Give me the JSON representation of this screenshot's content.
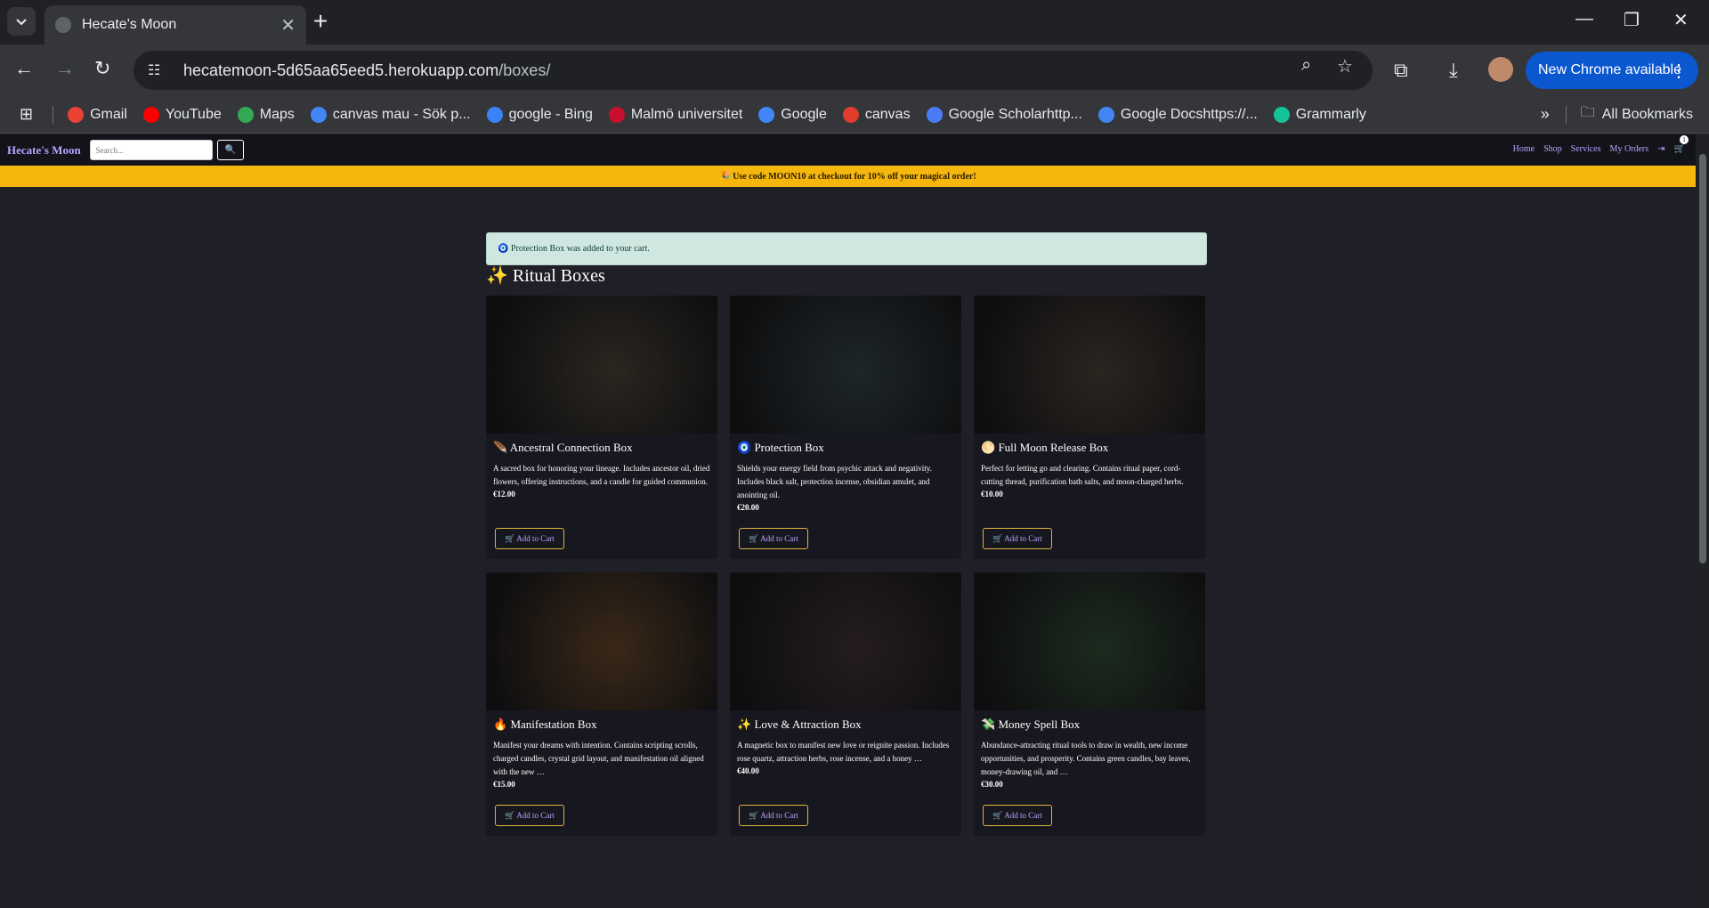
{
  "browser": {
    "tab_title": "Hecate's Moon",
    "url_host": "hecatemoon-5d65aa65eed5.herokuapp.com",
    "url_path": "/boxes/",
    "update_label": "New Chrome available",
    "bookmarks": [
      {
        "label": "Gmail",
        "color": "#ea4335"
      },
      {
        "label": "YouTube",
        "color": "#ff0000"
      },
      {
        "label": "Maps",
        "color": "#34a853"
      },
      {
        "label": "canvas mau - Sök p...",
        "color": "#4285f4"
      },
      {
        "label": "google - Bing",
        "color": "#3b82f6"
      },
      {
        "label": "Malmö universitet",
        "color": "#c8102e"
      },
      {
        "label": "Google",
        "color": "#4285f4"
      },
      {
        "label": "canvas",
        "color": "#e13c2c"
      },
      {
        "label": "Google Scholarhttp...",
        "color": "#4a7cf5"
      },
      {
        "label": "Google Docshttps://...",
        "color": "#4285f4"
      },
      {
        "label": "Grammarly",
        "color": "#15c39a"
      }
    ],
    "all_bookmarks": "All Bookmarks"
  },
  "site": {
    "brand": "Hecate's Moon",
    "search_placeholder": "Search...",
    "search_icon": "🔍",
    "nav": {
      "home": "Home",
      "shop": "Shop",
      "services": "Services",
      "orders": "My Orders",
      "cart_count": "1"
    },
    "promo": "🎉 Use code MOON10 at checkout for 10% off your magical order!",
    "alert": "🧿 Protection Box was added to your cart.",
    "section_title": "✨ Ritual Boxes",
    "add_label": "🛒 Add to Cart",
    "products": [
      {
        "emoji": "🪶",
        "name": "Ancestral Connection Box",
        "desc": "A sacred box for honoring your lineage. Includes ancestor oil, dried flowers, offering instructions, and a candle for guided communion.",
        "price": "€12.00",
        "tone": "#2a2620"
      },
      {
        "emoji": "🧿",
        "name": "Protection Box",
        "desc": "Shields your energy field from psychic attack and negativity. Includes black salt, protection incense, obsidian amulet, and anointing oil.",
        "price": "€20.00",
        "tone": "#1e2628"
      },
      {
        "emoji": "🌕",
        "name": "Full Moon Release Box",
        "desc": "Perfect for letting go and clearing. Contains ritual paper, cord-cutting thread, purification bath salts, and moon-charged herbs.",
        "price": "€10.00",
        "tone": "#2b2520"
      },
      {
        "emoji": "🔥",
        "name": "Manifestation Box",
        "desc": "Manifest your dreams with intention. Contains scripting scrolls, charged candles, crystal grid layout, and manifestation oil aligned with the new …",
        "price": "€15.00",
        "tone": "#3a2818"
      },
      {
        "emoji": "✨",
        "name": "Love & Attraction Box",
        "desc": "A magnetic box to manifest new love or reignite passion. Includes rose quartz, attraction herbs, rose incense, and a honey …",
        "price": "€40.00",
        "tone": "#241c20"
      },
      {
        "emoji": "💸",
        "name": "Money Spell Box",
        "desc": "Abundance-attracting ritual tools to draw in wealth, new income opportunities, and prosperity. Contains green candles, bay leaves, money-drawing oil, and …",
        "price": "€30.00",
        "tone": "#1c2a1e"
      }
    ]
  }
}
